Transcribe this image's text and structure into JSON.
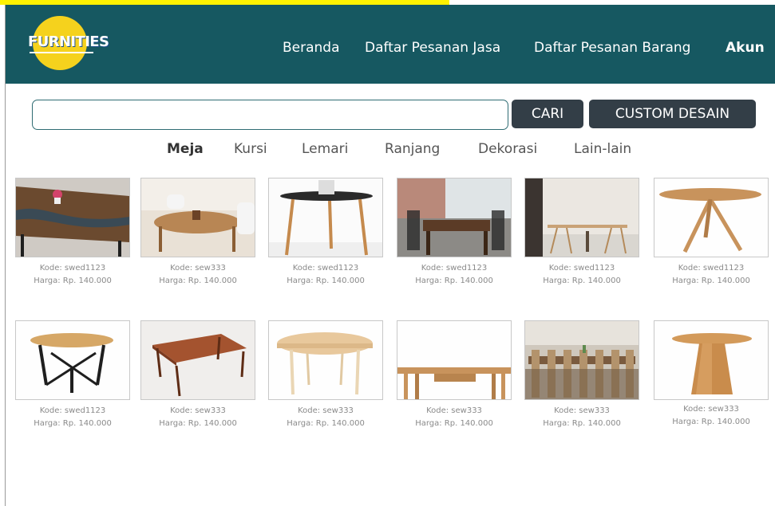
{
  "app": {
    "brand": "FURNITIES",
    "accent_color": "#165861",
    "logo_color": "#f5d21d",
    "button_color": "#333e47"
  },
  "nav": {
    "items": [
      "Beranda",
      "Daftar Pesanan Jasa",
      "Daftar Pesanan Barang",
      "Akun"
    ]
  },
  "search": {
    "value": "",
    "placeholder": "",
    "search_button": "CARI",
    "custom_button": "CUSTOM DESAIN"
  },
  "categories": {
    "items": [
      "Meja",
      "Kursi",
      "Lemari",
      "Ranjang",
      "Dekorasi",
      "Lain-lain"
    ],
    "active": "Meja"
  },
  "products": [
    {
      "code": "Kode: swed1123",
      "price": "Harga: Rp. 140.000",
      "image": "resin-river-table"
    },
    {
      "code": "Kode: sew333",
      "price": "Harga: Rp. 140.000",
      "image": "round-wood-table-with-chairs"
    },
    {
      "code": "Kode: swed1123",
      "price": "Harga: Rp. 140.000",
      "image": "black-top-round-side-table"
    },
    {
      "code": "Kode: swed1123",
      "price": "Harga: Rp. 140.000",
      "image": "dark-wood-dining-table"
    },
    {
      "code": "Kode: swed1123",
      "price": "Harga: Rp. 140.000",
      "image": "trestle-desk"
    },
    {
      "code": "Kode: swed1123",
      "price": "Harga: Rp. 140.000",
      "image": "round-splayed-leg-table"
    },
    {
      "code": "Kode: swed1123",
      "price": "Harga: Rp. 140.000",
      "image": "round-table-black-frame"
    },
    {
      "code": "Kode: sew333",
      "price": "Harga: Rp. 140.000",
      "image": "rectangular-wood-coffee-table"
    },
    {
      "code": "Kode: sew333",
      "price": "Harga: Rp. 140.000",
      "image": "oval-light-wood-table"
    },
    {
      "code": "Kode: sew333",
      "price": "Harga: Rp. 140.000",
      "image": "long-table-with-drawer"
    },
    {
      "code": "Kode: sew333",
      "price": "Harga: Rp. 140.000",
      "image": "dining-room-long-table"
    },
    {
      "code": "Kode: sew333",
      "price": "Harga: Rp. 140.000",
      "image": "round-pedestal-table"
    }
  ]
}
